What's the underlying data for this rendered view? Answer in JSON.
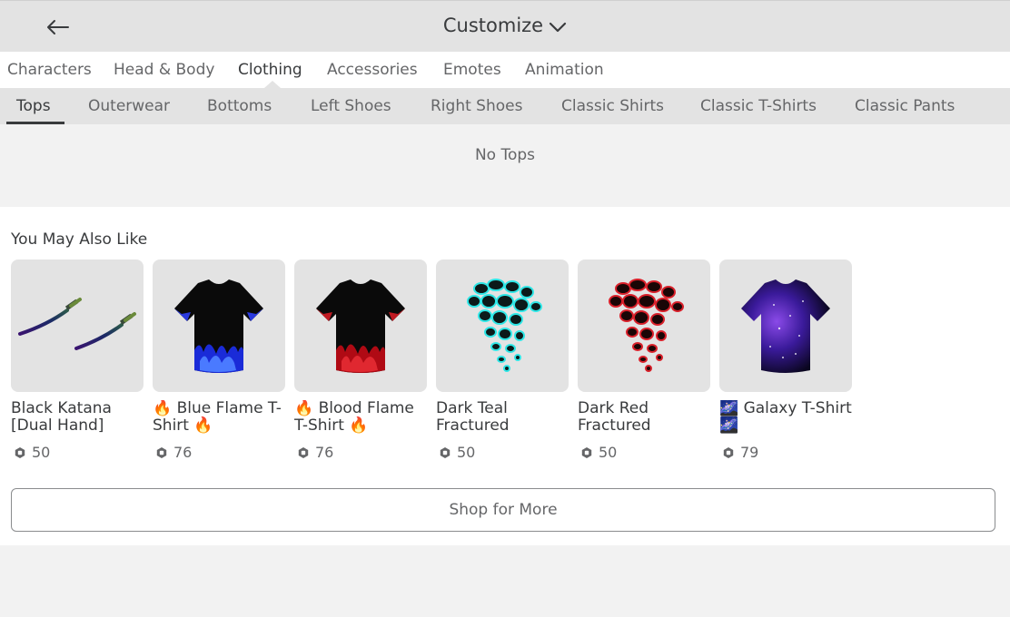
{
  "header": {
    "title": "Customize"
  },
  "categories": [
    {
      "label": "Characters",
      "active": false
    },
    {
      "label": "Head & Body",
      "active": false
    },
    {
      "label": "Clothing",
      "active": true
    },
    {
      "label": "Accessories",
      "active": false
    },
    {
      "label": "Emotes",
      "active": false
    },
    {
      "label": "Animation",
      "active": false
    }
  ],
  "subtabs": [
    {
      "label": "Tops",
      "active": true
    },
    {
      "label": "Outerwear",
      "active": false
    },
    {
      "label": "Bottoms",
      "active": false
    },
    {
      "label": "Left Shoes",
      "active": false
    },
    {
      "label": "Right Shoes",
      "active": false
    },
    {
      "label": "Classic Shirts",
      "active": false
    },
    {
      "label": "Classic T-Shirts",
      "active": false
    },
    {
      "label": "Classic Pants",
      "active": false
    }
  ],
  "empty_state": {
    "text": "No Tops"
  },
  "recommendations": {
    "title": "You May Also Like",
    "items": [
      {
        "name": "Black Katana [Dual Hand]",
        "price": "50",
        "thumb": "katana"
      },
      {
        "name": "🔥 Blue Flame T-Shirt 🔥",
        "price": "76",
        "thumb": "blue-flame-shirt"
      },
      {
        "name": "🔥 Blood Flame T-Shirt 🔥",
        "price": "76",
        "thumb": "blood-flame-shirt"
      },
      {
        "name": "Dark Teal Fractured",
        "price": "50",
        "thumb": "teal-fractured"
      },
      {
        "name": "Dark Red Fractured",
        "price": "50",
        "thumb": "red-fractured"
      },
      {
        "name": "🌌 Galaxy T-Shirt 🌌",
        "price": "79",
        "thumb": "galaxy-shirt"
      }
    ],
    "shop_label": "Shop for More"
  },
  "icons": {
    "back": "arrow-left-icon",
    "title_dropdown": "chevron-down-icon",
    "currency": "robux-icon"
  },
  "colors": {
    "header_bg": "#e3e3e3",
    "page_bg": "#f2f2f2",
    "panel_bg": "#ffffff",
    "text_primary": "#393b3d",
    "text_secondary": "#656668"
  }
}
